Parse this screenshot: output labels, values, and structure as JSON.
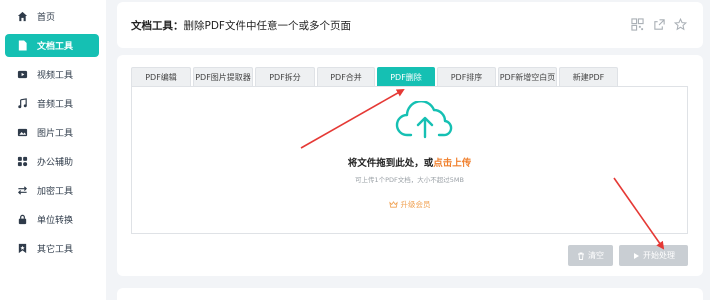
{
  "sidebar": {
    "items": [
      {
        "label": "首页",
        "icon": "home-icon"
      },
      {
        "label": "文档工具",
        "icon": "document-icon",
        "active": true
      },
      {
        "label": "视频工具",
        "icon": "video-icon"
      },
      {
        "label": "音频工具",
        "icon": "music-icon"
      },
      {
        "label": "图片工具",
        "icon": "image-icon"
      },
      {
        "label": "办公辅助",
        "icon": "office-icon"
      },
      {
        "label": "加密工具",
        "icon": "encrypt-icon"
      },
      {
        "label": "单位转换",
        "icon": "unit-convert-icon"
      },
      {
        "label": "其它工具",
        "icon": "other-tools-icon"
      }
    ]
  },
  "header": {
    "title_prefix": "文档工具：",
    "title_desc": "删除PDF文件中任意一个或多个页面",
    "icons": [
      "qrcode-icon",
      "share-icon",
      "star-icon"
    ]
  },
  "tabs": [
    {
      "label": "PDF编辑"
    },
    {
      "label": "PDF图片提取器"
    },
    {
      "label": "PDF拆分"
    },
    {
      "label": "PDF合并"
    },
    {
      "label": "PDF删除",
      "active": true
    },
    {
      "label": "PDF排序"
    },
    {
      "label": "PDF新增空白页"
    },
    {
      "label": "新建PDF"
    }
  ],
  "upload": {
    "main_text": "将文件拖到此处，或",
    "link_text": "点击上传",
    "hint": "可上传1个PDF文档，大小不超过5MB",
    "upgrade_label": "升级会员"
  },
  "buttons": {
    "clear_label": "清空",
    "start_label": "开始处理"
  },
  "colors": {
    "accent": "#15c0b3",
    "link": "#f0812f",
    "annotation": "#e53935"
  }
}
